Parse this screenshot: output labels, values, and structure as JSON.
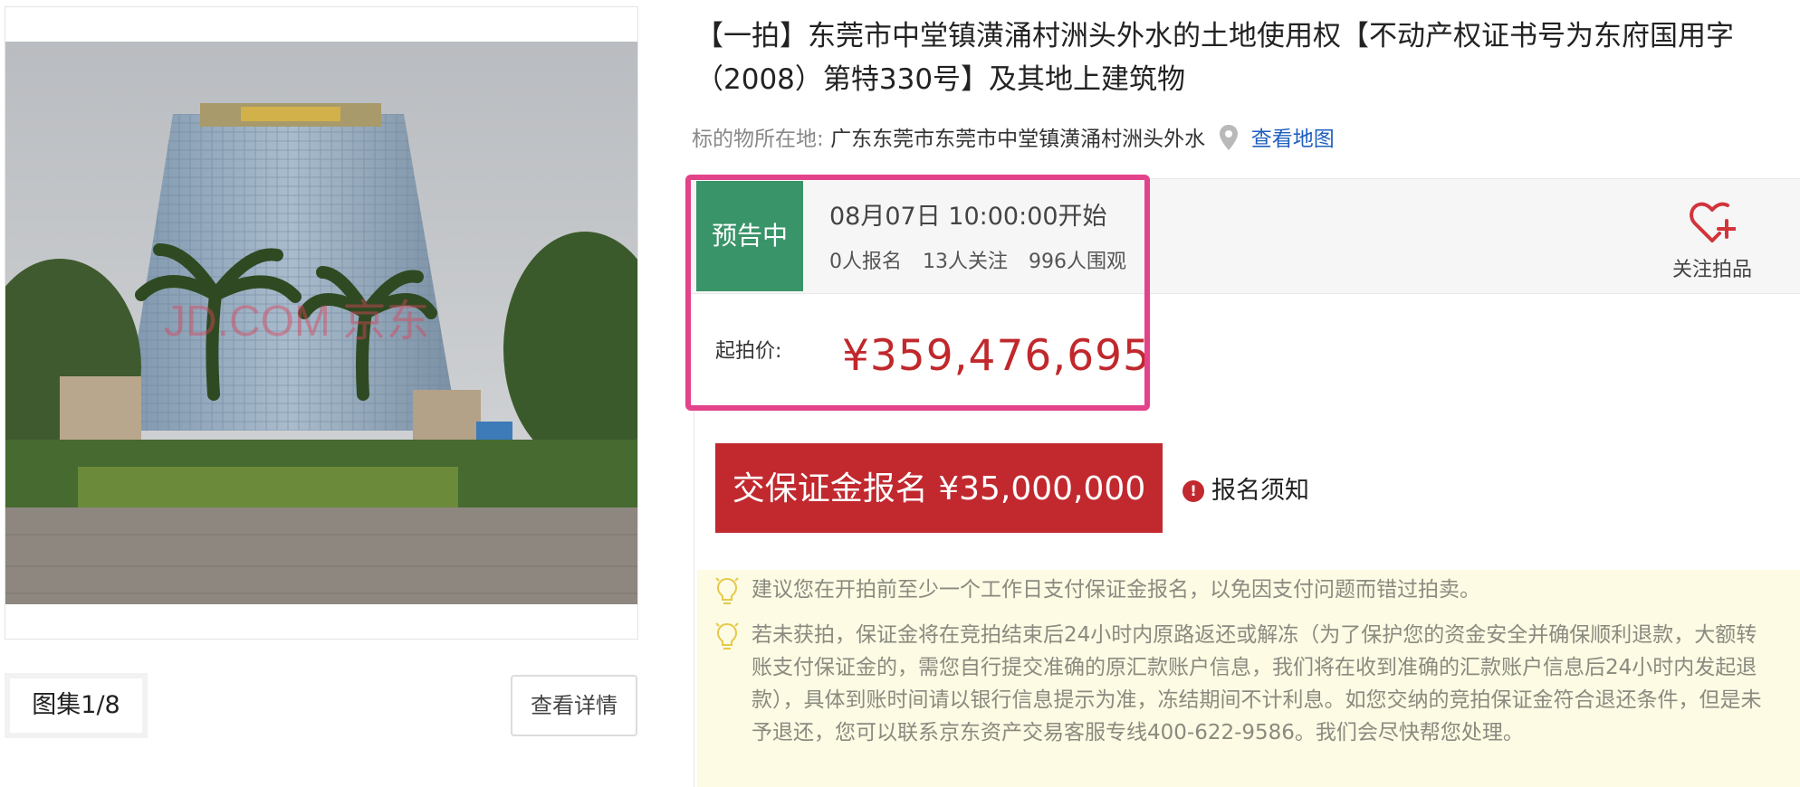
{
  "gallery": {
    "counter": "图集1/8",
    "view_details": "查看详情"
  },
  "lot": {
    "title": "【一拍】东莞市中堂镇潢涌村洲头外水的土地使用权【不动产权证书号为东府国用字（2008）第特330号】及其地上建筑物",
    "location_label": "标的物所在地:",
    "location_value": "广东东莞市东莞市中堂镇潢涌村洲头外水",
    "map_link": "查看地图"
  },
  "status": {
    "badge": "预告中",
    "start_time": "08月07日 10:00:00开始",
    "registrations": "0人报名",
    "followers": "13人关注",
    "viewers": "996人围观",
    "follow_label": "关注拍品"
  },
  "price": {
    "label": "起拍价:",
    "value": "¥359,476,695"
  },
  "actions": {
    "deposit_button": "交保证金报名 ¥35,000,000",
    "notice_link": "报名须知"
  },
  "tips": [
    "建议您在开拍前至少一个工作日支付保证金报名，以免因支付问题而错过拍卖。",
    "若未获拍，保证金将在竞拍结束后24小时内原路返还或解冻（为了保护您的资金安全并确保顺利退款，大额转账支付保证金的，需您自行提交准确的原汇款账户信息，我们将在收到准确的汇款账户信息后24小时内发起退款），具体到账时间请以银行信息提示为准，冻结期间不计利息。如您交纳的竞拍保证金符合退还条件，但是未予退还，您可以联系京东资产交易客服专线400-622-9586。我们会尽快帮您处理。"
  ],
  "colors": {
    "badge": "#3a9469",
    "price": "#c0282c",
    "deposit_button": "#c1292f",
    "highlight": "#e2438a",
    "link": "#1f5fbf",
    "tips_bg": "#fdfbe3"
  },
  "icons": {
    "location": "map-pin-icon",
    "follow": "heart-plus-icon",
    "notice": "exclamation-icon",
    "tip": "lightbulb-icon"
  },
  "photo": {
    "watermark": "JD.COM 京东"
  }
}
